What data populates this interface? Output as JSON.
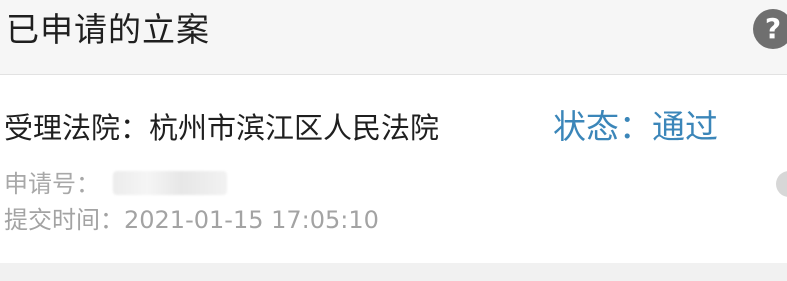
{
  "header": {
    "title": "已申请的立案",
    "help_icon_glyph": "?"
  },
  "case": {
    "court_label": "受理法院：",
    "court_name": "杭州市滨江区人民法院",
    "status_label": "状态：",
    "status_value": "通过",
    "application_no_label": "申请号：",
    "submit_time_label": "提交时间：",
    "submit_time_value": "2021-01-15 17:05:10"
  },
  "colors": {
    "status": "#3b86b9",
    "muted_text": "#a8a8a8",
    "primary_text": "#1f1f1f"
  }
}
